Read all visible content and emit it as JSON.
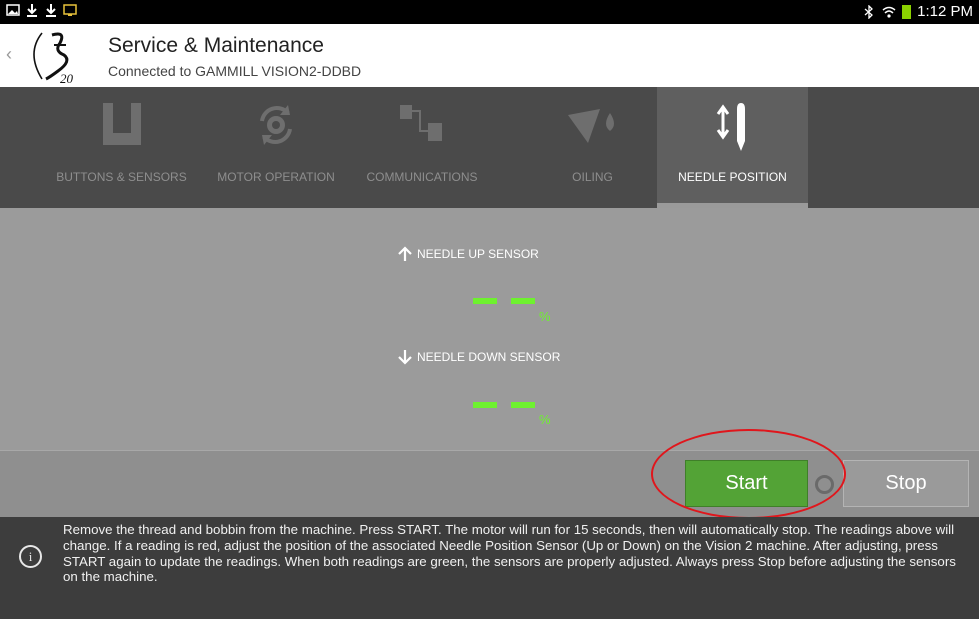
{
  "status_bar": {
    "time": "1:12 PM",
    "left_icons": [
      "gallery-icon",
      "download-icon",
      "download-icon",
      "cast-icon"
    ],
    "right_icons": [
      "bluetooth-icon",
      "wifi-icon",
      "battery-icon"
    ],
    "battery_color": "#8bd100"
  },
  "header": {
    "title": "Service & Maintenance",
    "subtitle": "Connected to GAMMILL VISION2-DDBD",
    "logo_text": "20"
  },
  "tabs": [
    {
      "label": "BUTTONS & SENSORS",
      "icon": "buttons-sensors-icon",
      "active": false
    },
    {
      "label": "MOTOR OPERATION",
      "icon": "motor-gear-icon",
      "active": false
    },
    {
      "label": "COMMUNICATIONS",
      "icon": "communications-icon",
      "active": false
    },
    {
      "label": "OILING",
      "icon": "oil-can-icon",
      "active": false
    },
    {
      "label": "NEEDLE POSITION",
      "icon": "needle-icon",
      "active": true
    }
  ],
  "sensors": {
    "up_label": "NEEDLE UP SENSOR",
    "up_value": "– –",
    "down_label": "NEEDLE DOWN SENSOR",
    "down_value": "– –",
    "unit": "%",
    "reading_color": "#6ef12f"
  },
  "actions": {
    "start_label": "Start",
    "stop_label": "Stop",
    "start_color": "#53a336"
  },
  "info": {
    "text": "Remove the thread and bobbin from the machine. Press START. The motor will run for 15 seconds, then will automatically stop. The readings above will change. If a reading is red, adjust the position of the associated Needle Position Sensor (Up or Down) on the Vision 2 machine. After adjusting, press START again to update the readings. When both readings are green, the sensors are properly adjusted. Always press Stop before adjusting the sensors on the machine."
  }
}
